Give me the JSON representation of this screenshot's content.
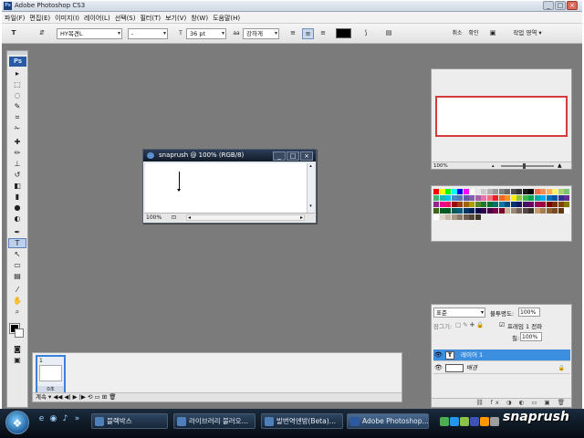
{
  "app": {
    "window_title": "Adobe Photoshop CS3",
    "ps_badge": "Ps"
  },
  "window_controls": {
    "minimize": "_",
    "maximize": "□",
    "close": "×"
  },
  "menu": [
    "파일(F)",
    "편집(E)",
    "이미지(I)",
    "레이어(L)",
    "선택(S)",
    "필터(T)",
    "보기(V)",
    "창(W)",
    "도움말(H)"
  ],
  "options_bar": {
    "tool_glyph": "T",
    "orient_glyph": "⇵",
    "font_family": "HY목견L",
    "font_style": "-",
    "size_glyph": "T",
    "font_size": "36 pt",
    "aa_glyph": "aa",
    "antialias": "강하게",
    "align_left": "≡",
    "align_center": "≡",
    "align_right": "≡",
    "warp_glyph": "⟆",
    "panels_glyph": "▤",
    "cancel_label": "취소",
    "commit_label": "확인",
    "workspace_icon_glyph": "▣",
    "workspace_label": "작업 영역 ▾"
  },
  "tools": {
    "logo": "Ps",
    "items": [
      {
        "name": "move",
        "glyph": "▸"
      },
      {
        "name": "marquee",
        "glyph": "⬚"
      },
      {
        "name": "lasso",
        "glyph": "◌"
      },
      {
        "name": "quick-select",
        "glyph": "✎"
      },
      {
        "name": "crop",
        "glyph": "⌗"
      },
      {
        "name": "slice",
        "glyph": "✁"
      },
      {
        "name": "healing",
        "glyph": "✚"
      },
      {
        "name": "brush",
        "glyph": "✏"
      },
      {
        "name": "clone-stamp",
        "glyph": "⊥"
      },
      {
        "name": "history-brush",
        "glyph": "↺"
      },
      {
        "name": "eraser",
        "glyph": "◧"
      },
      {
        "name": "gradient",
        "glyph": "▮"
      },
      {
        "name": "blur",
        "glyph": "●"
      },
      {
        "name": "dodge",
        "glyph": "◐"
      },
      {
        "name": "pen",
        "glyph": "✒"
      },
      {
        "name": "type",
        "glyph": "T"
      },
      {
        "name": "path-select",
        "glyph": "↖"
      },
      {
        "name": "shape",
        "glyph": "▭"
      },
      {
        "name": "notes",
        "glyph": "▤"
      },
      {
        "name": "eyedropper",
        "glyph": "⁄"
      },
      {
        "name": "hand",
        "glyph": "✋"
      },
      {
        "name": "zoom",
        "glyph": "⌕"
      }
    ],
    "quick_mask_glyph": "◙",
    "screen_mode_glyph": "▣"
  },
  "document": {
    "title": "snaprush @ 100% (RGB/8)",
    "zoom": "100%",
    "status_icon": "⊡",
    "scroll_left": "◂",
    "scroll_right": "▸",
    "scroll_up": "▴",
    "scroll_down": "▾"
  },
  "navigator": {
    "zoom": "100%",
    "zoom_out": "▴",
    "zoom_in": "▲"
  },
  "swatches": {
    "colors": [
      "#ff0000",
      "#ffff00",
      "#00ff00",
      "#00ffff",
      "#0000ff",
      "#ff00ff",
      "#ffffff",
      "#e6e6e6",
      "#cccccc",
      "#b3b3b3",
      "#999999",
      "#808080",
      "#666666",
      "#4d4d4d",
      "#333333",
      "#1a1a1a",
      "#000000",
      "#f26c4f",
      "#f68e55",
      "#fbaf5c",
      "#fff467",
      "#acd372",
      "#7cc576",
      "#3bb878",
      "#1abbb4",
      "#00bff3",
      "#438ccb",
      "#5574b9",
      "#605ca8",
      "#855fa8",
      "#a763a8",
      "#f06eaa",
      "#f26d7d",
      "#ed1c24",
      "#f26522",
      "#f7941d",
      "#fff200",
      "#8dc63f",
      "#39b54a",
      "#00a651",
      "#00a99d",
      "#00aeef",
      "#0072bc",
      "#0054a6",
      "#2e3192",
      "#662d91",
      "#92278f",
      "#ec008c",
      "#ed145b",
      "#9e0b0f",
      "#a0410d",
      "#a3620a",
      "#aba000",
      "#598527",
      "#197b30",
      "#007236",
      "#00746b",
      "#0076a3",
      "#004b80",
      "#003471",
      "#1b1464",
      "#440e62",
      "#630460",
      "#9e005d",
      "#9e0039",
      "#790000",
      "#7b2e00",
      "#7d4900",
      "#827b00",
      "#406618",
      "#005e20",
      "#005826",
      "#005952",
      "#005b7f",
      "#003663",
      "#002157",
      "#0d004c",
      "#32004b",
      "#4b0049",
      "#7b0046",
      "#7a0026",
      "#c7b299",
      "#998675",
      "#736357",
      "#534741",
      "#37302a",
      "#c69c6d",
      "#a67c52",
      "#8c6239",
      "#754c24",
      "#603913",
      "#ffffff",
      "#ffffff",
      "#e0d6c8",
      "#c8b8a8",
      "#a89888",
      "#8a7868",
      "#6e5c4e",
      "#524436",
      "#3a3026"
    ]
  },
  "layers": {
    "blend_mode": "표준",
    "opacity_label": "불투명도:",
    "opacity": "100%",
    "lock_label": "잠그기:",
    "lock_icons": "□ ✎ ✚ 🔒",
    "unify_label": "프레임 1 전파",
    "fill_label": "칠:",
    "fill": "100%",
    "items": [
      {
        "name": "레이어 1",
        "thumb": "T",
        "visible": "👁"
      },
      {
        "name": "배경",
        "thumb": "",
        "visible": "👁",
        "lock": "🔒"
      }
    ],
    "bottom_icons": "⛓ fx ◑ ◐ ▭ ▣ 🗑"
  },
  "animation": {
    "frame_number": "1",
    "frame_delay": "0초",
    "bar": "계속 ▾   ◀◀  ◀|  ▶  |▶  ⟲  ▭  ⊞  🗑"
  },
  "taskbar": {
    "start_glyph": "❖",
    "quicklaunch": [
      "e",
      "◉",
      "♪",
      "»"
    ],
    "buttons": [
      {
        "label": "블랙박스",
        "active": false
      },
      {
        "label": "라이브러리 불러오…",
        "active": false
      },
      {
        "label": "발번역엔방(Beta)…",
        "active": false
      },
      {
        "label": "Adobe Photoshop…",
        "active": true
      }
    ],
    "tray_colors": [
      "#4caf50",
      "#2196f3",
      "#8bc34a",
      "#3f51b5",
      "#ff9800",
      "#9e9e9e"
    ],
    "watermark": "snaprush"
  }
}
